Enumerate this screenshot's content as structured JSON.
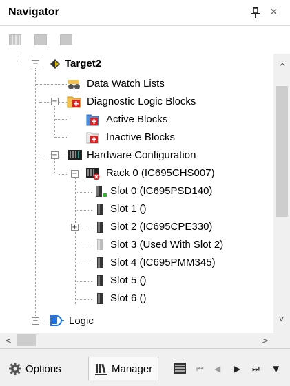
{
  "panel": {
    "title": "Navigator",
    "close_glyph": "×"
  },
  "toolbar": {
    "icons": [
      "grid-icon",
      "properties-icon",
      "list-icon"
    ]
  },
  "tree": {
    "target": "Target2",
    "data_watch": "Data Watch Lists",
    "diag_blocks": "Diagnostic Logic Blocks",
    "active_blocks": "Active Blocks",
    "inactive_blocks": "Inactive Blocks",
    "hardware": "Hardware Configuration",
    "rack": "Rack 0 (IC695CHS007)",
    "slots": [
      "Slot 0 (IC695PSD140)",
      "Slot 1 ()",
      "Slot 2 (IC695CPE330)",
      "Slot 3 (Used With Slot 2)",
      "Slot 4 (IC695PMM345)",
      "Slot 5 ()",
      "Slot 6 ()"
    ],
    "logic": "Logic",
    "expander_plus": "+",
    "expander_minus": "−"
  },
  "scroll": {
    "up": "^",
    "down": "v",
    "left": "<",
    "right": ">"
  },
  "tabs": {
    "options": "Options",
    "manager": "Manager"
  },
  "nav": {
    "first": "⏮",
    "prev": "◀",
    "next": "▶",
    "last": "⏭",
    "menu": "▼"
  },
  "colors": {
    "red_badge": "#e02020",
    "folder": "#f0c050",
    "green_led": "#2db82d",
    "blue_logic": "#1a73e8"
  }
}
